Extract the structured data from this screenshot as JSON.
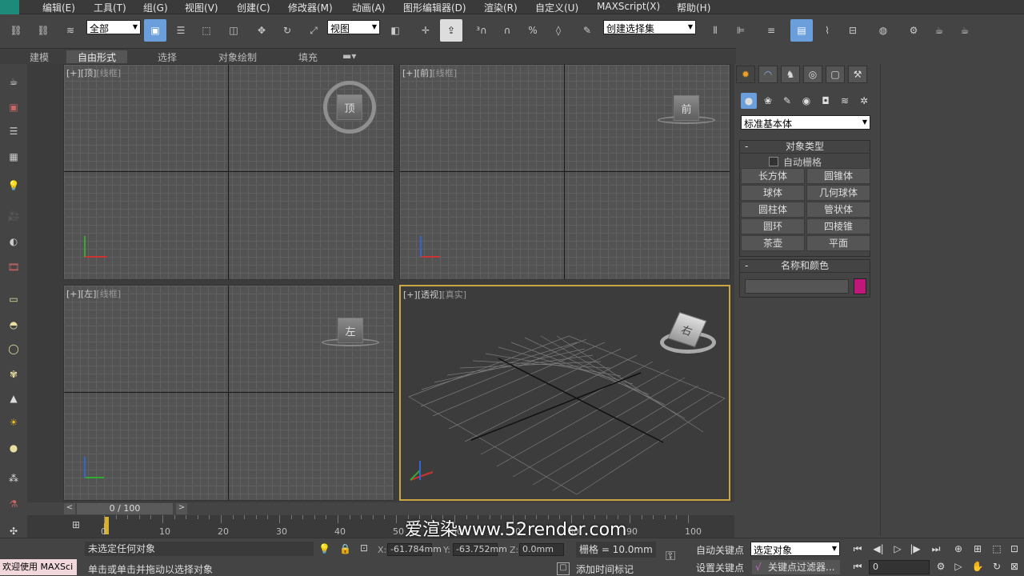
{
  "menu": {
    "items": [
      "编辑(E)",
      "工具(T)",
      "组(G)",
      "视图(V)",
      "创建(C)",
      "修改器(M)",
      "动画(A)",
      "图形编辑器(D)",
      "渲染(R)",
      "自定义(U)",
      "MAXScript(X)",
      "帮助(H)"
    ]
  },
  "toolbar": {
    "selection_filter": "全部",
    "ref_coord": "视图",
    "named_selection": "创建选择集"
  },
  "ribbon": {
    "tabs": [
      "建模",
      "自由形式",
      "选择",
      "对象绘制",
      "填充"
    ],
    "active": "自由形式"
  },
  "viewports": [
    {
      "plus": "[+]",
      "name": "[顶]",
      "shading": "[线框]"
    },
    {
      "plus": "[+]",
      "name": "[前]",
      "shading": "[线框]"
    },
    {
      "plus": "[+]",
      "name": "[左]",
      "shading": "[线框]"
    },
    {
      "plus": "[+]",
      "name": "[透视]",
      "shading": "[真实]"
    }
  ],
  "viewcube": {
    "top": "顶",
    "front": "前",
    "left": "左",
    "persp": "右"
  },
  "command_panel": {
    "category": "标准基本体",
    "object_type_title": "对象类型",
    "autogrid": "自动栅格",
    "buttons": [
      "长方体",
      "圆锥体",
      "球体",
      "几何球体",
      "圆柱体",
      "管状体",
      "圆环",
      "四棱锥",
      "茶壶",
      "平面"
    ],
    "name_color_title": "名称和颜色",
    "name_value": "",
    "color": "#c0187a"
  },
  "timeline": {
    "prev": "<",
    "frame": "0 / 100",
    "next": ">",
    "ticks": [
      "0",
      "10",
      "20",
      "30",
      "40",
      "50",
      "60",
      "70",
      "80",
      "90",
      "100"
    ]
  },
  "status": {
    "welcome": "欢迎使用 MAXSci",
    "line1": "未选定任何对象",
    "line2": "单击或单击并拖动以选择对象",
    "x_label": "X:",
    "x_value": "-61.784mm",
    "y_label": "Y:",
    "y_value": "-63.752mm",
    "z_label": "Z:",
    "z_value": "0.0mm",
    "grid": "栅格 = 10.0mm",
    "add_time_tag": "添加时间标记",
    "auto_key": "自动关键点",
    "set_key": "设置关键点",
    "key_target": "选定对象",
    "key_filter": "关键点过滤器...",
    "frame_spinner": "0"
  },
  "watermark": "爱渲染www.52render.com"
}
